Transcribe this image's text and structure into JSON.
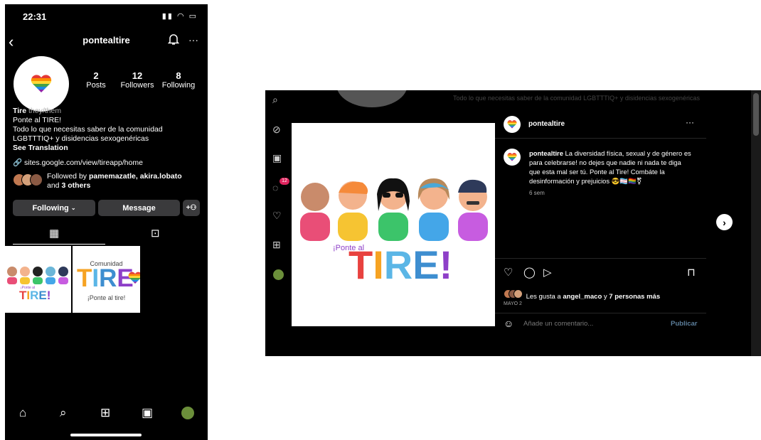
{
  "phone": {
    "status_time": "22:31",
    "username": "pontealtire",
    "stats": [
      {
        "value": "2",
        "label": "Posts"
      },
      {
        "value": "12",
        "label": "Followers"
      },
      {
        "value": "8",
        "label": "Following"
      }
    ],
    "bio": {
      "name": "Tire",
      "pronouns": "they/them",
      "line1": "Ponte al TIRE!",
      "line2": "Todo lo que necesitas saber de la comunidad",
      "line3": "LGBTTTIQ+ y disidencias sexogenéricas",
      "see_translation": "See Translation"
    },
    "link": "sites.google.com/view/tireapp/home",
    "followed_by": {
      "prefix": "Followed by",
      "names": "pamemazatle, akira.lobato",
      "and": "and",
      "others": "3 others"
    },
    "buttons": {
      "following": "Following",
      "message": "Message"
    },
    "thumb1": {
      "ponte": "¡Ponte al",
      "tire": "TIRE!"
    },
    "thumb2": {
      "comunidad": "Comunidad",
      "tire": "TIRE",
      "ponte": "¡Ponte al tire!"
    }
  },
  "desktop": {
    "bg_text": "Todo lo que necesitas saber de la comunidad LGBTTTIQ+ y disidencias sexogenéricas",
    "notification_count": "12",
    "post_image": {
      "ponte": "¡Ponte al",
      "tire": "TIRE!"
    },
    "username": "pontealtire",
    "caption_user": "pontealtire",
    "caption": "La diversidad física, sexual y de género es para celebrarse! no dejes que nadie ni nada te diga que esta mal ser tú. Ponte al Tire! Combáte la desinformación y prejuicios 😎🏳️‍⚧️🏳️‍🌈⚧",
    "time_ago": "6 sem",
    "likes": {
      "prefix": "Les gusta a",
      "user": "angel_maco",
      "mid": "y",
      "rest": "7 personas más"
    },
    "date": "MAYO 2",
    "comment_placeholder": "Añade un comentario...",
    "publish": "Publicar"
  },
  "colors": {
    "tire_t": "#e8423f",
    "tire_i": "#f6a323",
    "tire_r": "#5bb6e6",
    "tire_e": "#3e8ed0",
    "tire_excl": "#8e3fc8",
    "publish": "#5c7f9c"
  }
}
